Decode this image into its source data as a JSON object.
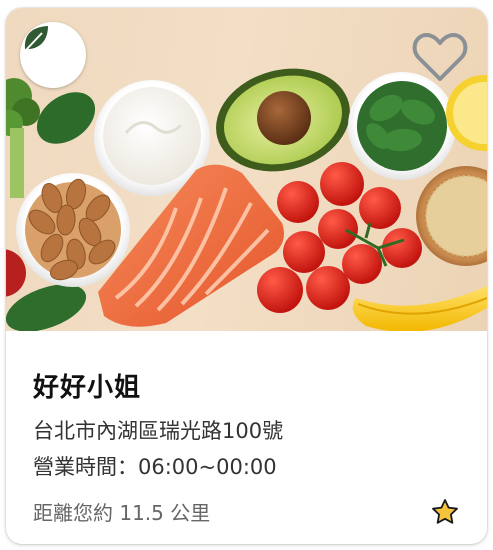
{
  "restaurant": {
    "name": "好好小姐",
    "address": "台北市內湖區瑞光路100號",
    "hours": "營業時間：06:00~00:00",
    "distance": "距離您約 11.5 公里"
  },
  "icons": {
    "logo": "leaf-icon",
    "favorite": "heart-outline-icon",
    "rating": "star-icon"
  },
  "colors": {
    "logo_leaf": "#2f5a32",
    "heart_outline": "#8a9096",
    "star_fill": "#f6c33c",
    "star_stroke": "#1a1a1a"
  }
}
